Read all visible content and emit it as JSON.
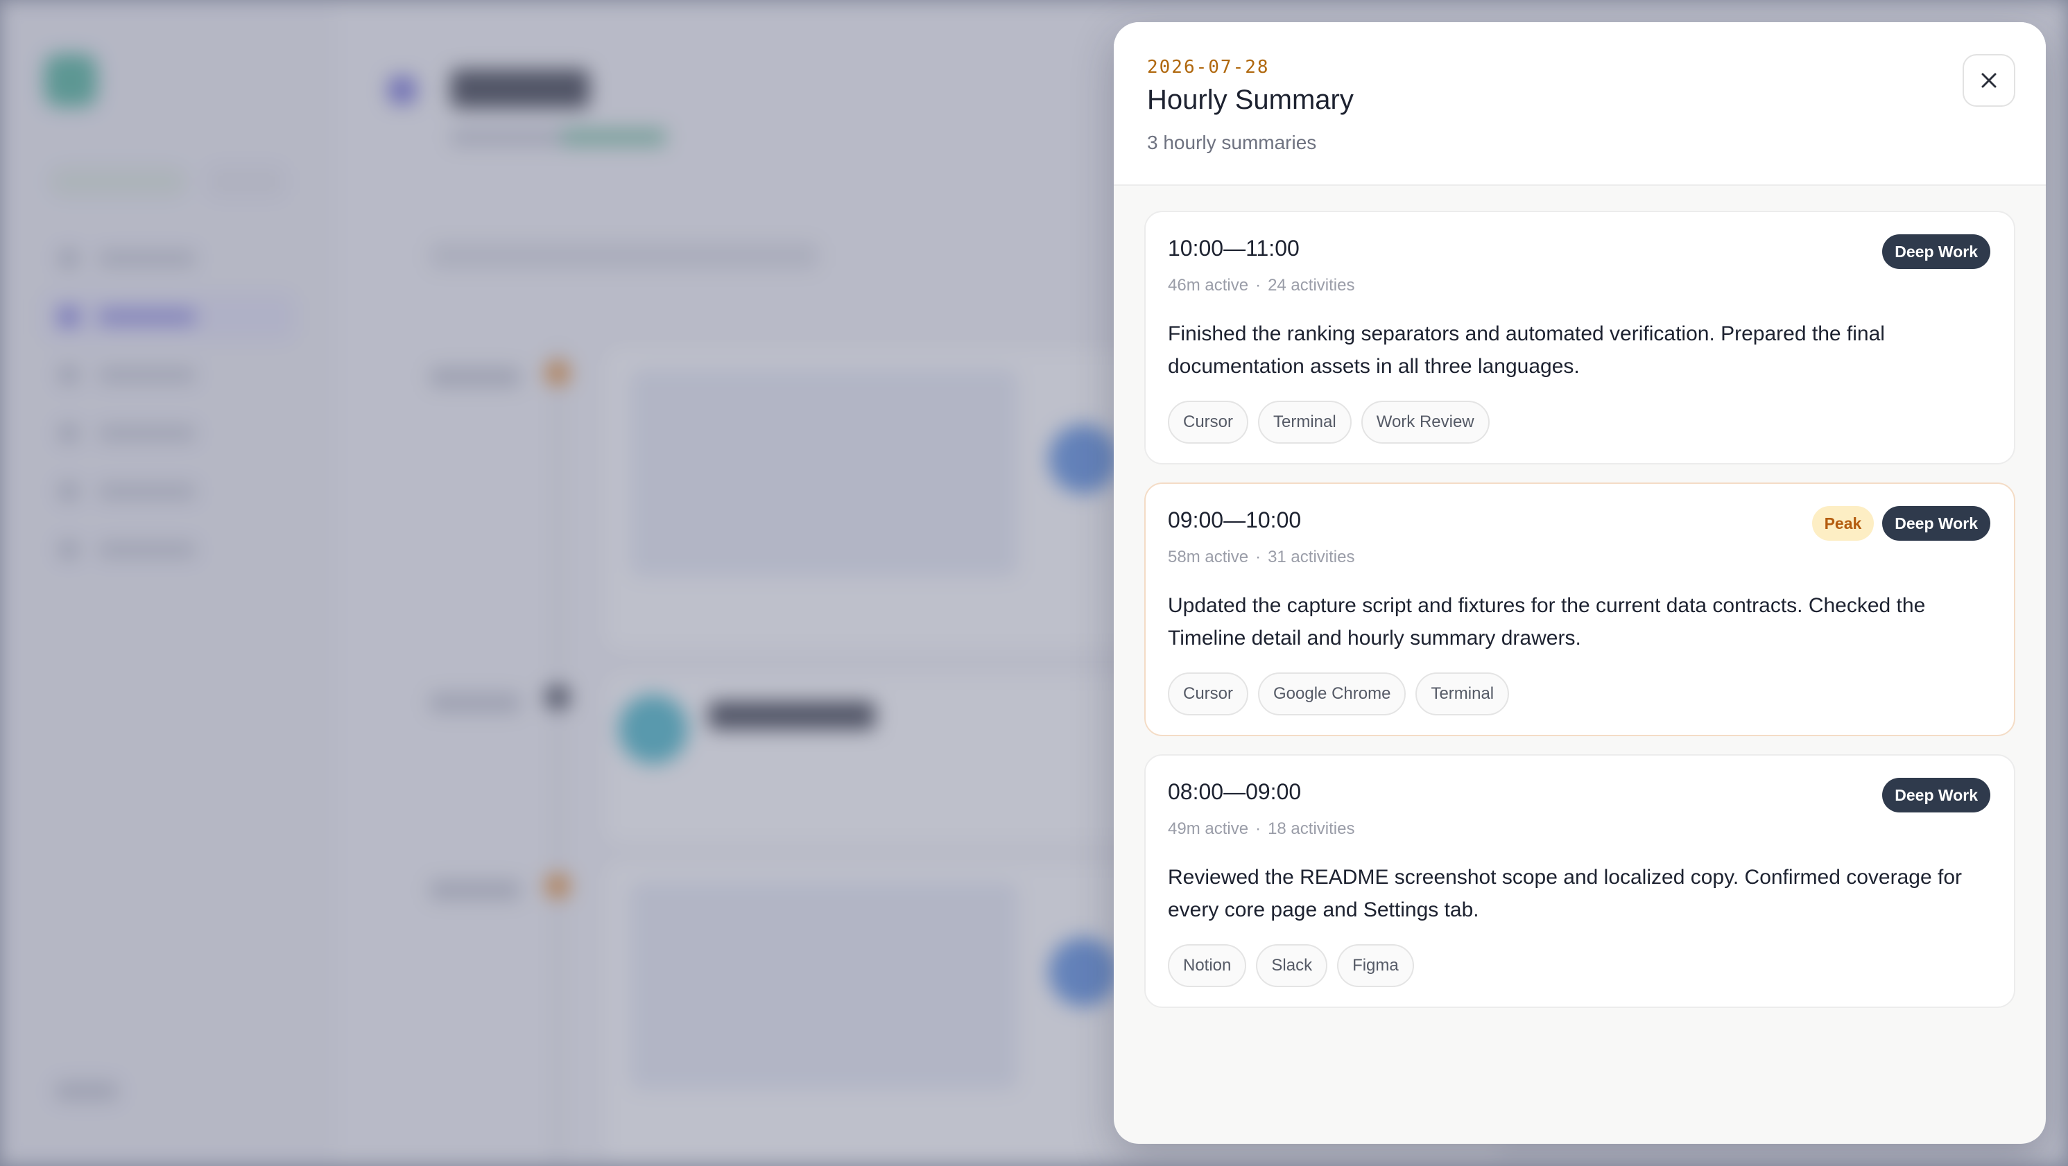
{
  "drawer": {
    "date": "2026-07-28",
    "title": "Hourly Summary",
    "count_text": "3 hourly summaries",
    "close_icon": "close-icon"
  },
  "summaries": [
    {
      "time_range": "10:00—11:00",
      "active": "46m active",
      "separator": "·",
      "activities": "24 activities",
      "badges": {
        "peak": "",
        "category": "Deep Work"
      },
      "body": "Finished the ranking separators and automated verification. Prepared the final documentation assets in all three languages.",
      "tags": [
        "Cursor",
        "Terminal",
        "Work Review"
      ]
    },
    {
      "time_range": "09:00—10:00",
      "active": "58m active",
      "separator": "·",
      "activities": "31 activities",
      "badges": {
        "peak": "Peak",
        "category": "Deep Work"
      },
      "body": "Updated the capture script and fixtures for the current data contracts. Checked the Timeline detail and hourly summary drawers.",
      "tags": [
        "Cursor",
        "Google Chrome",
        "Terminal"
      ]
    },
    {
      "time_range": "08:00—09:00",
      "active": "49m active",
      "separator": "·",
      "activities": "18 activities",
      "badges": {
        "peak": "",
        "category": "Deep Work"
      },
      "body": "Reviewed the README screenshot scope and localized copy. Confirmed coverage for every core page and Settings tab.",
      "tags": [
        "Notion",
        "Slack",
        "Figma"
      ]
    }
  ],
  "colors": {
    "accent_date": "#b0680e",
    "badge_dark": "#2f3a4c",
    "badge_peak_bg": "#fdeec4",
    "badge_peak_text": "#b45c0f",
    "nav_active": "#6b66d9"
  }
}
